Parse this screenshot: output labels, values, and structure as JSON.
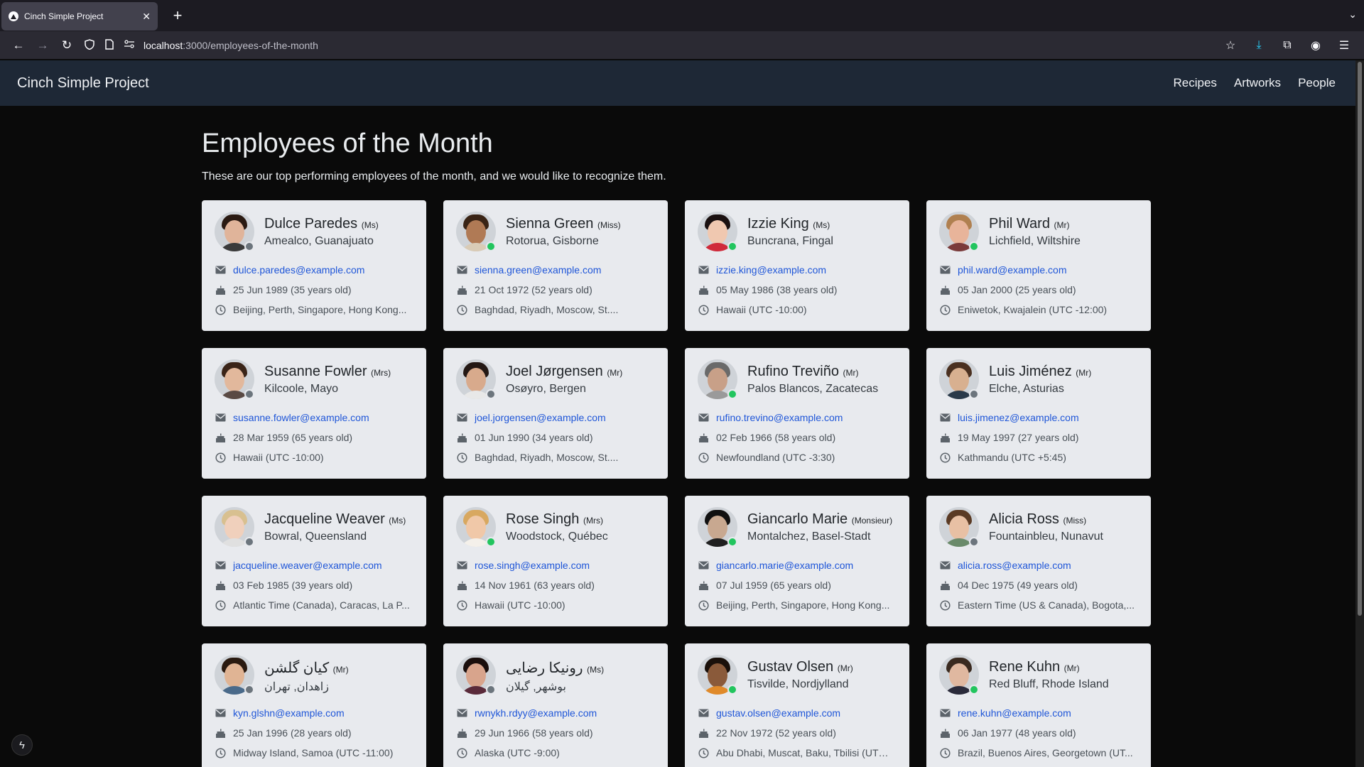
{
  "browser": {
    "tab_title": "Cinch Simple Project",
    "url_host": "localhost",
    "url_path": ":3000/employees-of-the-month"
  },
  "site": {
    "brand": "Cinch Simple Project",
    "nav": [
      "Recipes",
      "Artworks",
      "People"
    ]
  },
  "page": {
    "title": "Employees of the Month",
    "subtitle": "These are our top performing employees of the month, and we would like to recognize them."
  },
  "employees": [
    {
      "name": "Dulce Paredes",
      "title": "(Ms)",
      "location": "Amealco, Guanajuato",
      "email": "dulce.paredes@example.com",
      "birthday": "25 Jun 1989 (35 years old)",
      "timezone": "Beijing, Perth, Singapore, Hong Kong...",
      "online": false,
      "skin": "#e0b49a",
      "hair": "#2a1a12",
      "shirt": "#3b3b3b"
    },
    {
      "name": "Sienna Green",
      "title": "(Miss)",
      "location": "Rotorua, Gisborne",
      "email": "sienna.green@example.com",
      "birthday": "21 Oct 1972 (52 years old)",
      "timezone": "Baghdad, Riyadh, Moscow, St....",
      "online": true,
      "skin": "#b07a55",
      "hair": "#3a2416",
      "shirt": "#d9cbb6"
    },
    {
      "name": "Izzie King",
      "title": "(Ms)",
      "location": "Buncrana, Fingal",
      "email": "izzie.king@example.com",
      "birthday": "05 May 1986 (38 years old)",
      "timezone": "Hawaii (UTC -10:00)",
      "online": true,
      "skin": "#f0c8b0",
      "hair": "#1a1010",
      "shirt": "#d02a3a"
    },
    {
      "name": "Phil Ward",
      "title": "(Mr)",
      "location": "Lichfield, Wiltshire",
      "email": "phil.ward@example.com",
      "birthday": "05 Jan 2000 (25 years old)",
      "timezone": "Eniwetok, Kwajalein (UTC -12:00)",
      "online": true,
      "skin": "#e8b49a",
      "hair": "#b08050",
      "shirt": "#7a3b3b"
    },
    {
      "name": "Susanne Fowler",
      "title": "(Mrs)",
      "location": "Kilcoole, Mayo",
      "email": "susanne.fowler@example.com",
      "birthday": "28 Mar 1959 (65 years old)",
      "timezone": "Hawaii (UTC -10:00)",
      "online": false,
      "skin": "#e2b89c",
      "hair": "#3a2418",
      "shirt": "#5a4a44"
    },
    {
      "name": "Joel Jørgensen",
      "title": "(Mr)",
      "location": "Osøyro, Bergen",
      "email": "joel.jorgensen@example.com",
      "birthday": "01 Jun 1990 (34 years old)",
      "timezone": "Baghdad, Riyadh, Moscow, St....",
      "online": false,
      "skin": "#d8aa8c",
      "hair": "#241814",
      "shirt": "#e8e8e8"
    },
    {
      "name": "Rufino Treviño",
      "title": "(Mr)",
      "location": "Palos Blancos, Zacatecas",
      "email": "rufino.trevino@example.com",
      "birthday": "02 Feb 1966 (58 years old)",
      "timezone": "Newfoundland (UTC -3:30)",
      "online": true,
      "skin": "#c8a088",
      "hair": "#6a6a6a",
      "shirt": "#9a9a9a"
    },
    {
      "name": "Luis Jiménez",
      "title": "(Mr)",
      "location": "Elche, Asturias",
      "email": "luis.jimenez@example.com",
      "birthday": "19 May 1997 (27 years old)",
      "timezone": "Kathmandu (UTC +5:45)",
      "online": false,
      "skin": "#d8b090",
      "hair": "#4a3020",
      "shirt": "#2a3a4a"
    },
    {
      "name": "Jacqueline Weaver",
      "title": "(Ms)",
      "location": "Bowral, Queensland",
      "email": "jacqueline.weaver@example.com",
      "birthday": "03 Feb 1985 (39 years old)",
      "timezone": "Atlantic Time (Canada), Caracas, La P...",
      "online": false,
      "skin": "#f0d0bc",
      "hair": "#d8c090",
      "shirt": "#e0e0e0"
    },
    {
      "name": "Rose Singh",
      "title": "(Mrs)",
      "location": "Woodstock, Québec",
      "email": "rose.singh@example.com",
      "birthday": "14 Nov 1961 (63 years old)",
      "timezone": "Hawaii (UTC -10:00)",
      "online": true,
      "skin": "#f0c8a8",
      "hair": "#d8a860",
      "shirt": "#f4f0ea"
    },
    {
      "name": "Giancarlo Marie",
      "title": "(Monsieur)",
      "location": "Montalchez, Basel-Stadt",
      "email": "giancarlo.marie@example.com",
      "birthday": "07 Jul 1959 (65 years old)",
      "timezone": "Beijing, Perth, Singapore, Hong Kong...",
      "online": true,
      "skin": "#c8a890",
      "hair": "#101010",
      "shirt": "#202020"
    },
    {
      "name": "Alicia Ross",
      "title": "(Miss)",
      "location": "Fountainbleu, Nunavut",
      "email": "alicia.ross@example.com",
      "birthday": "04 Dec 1975 (49 years old)",
      "timezone": "Eastern Time (US & Canada), Bogota,...",
      "online": false,
      "skin": "#e8c0a4",
      "hair": "#5a3a24",
      "shirt": "#6a8a6a"
    },
    {
      "name": "کیان گلشن",
      "title": "(Mr)",
      "rtl": true,
      "location": "زاهدان, تهران",
      "email": "kyn.glshn@example.com",
      "birthday": "25 Jan 1996 (28 years old)",
      "timezone": "Midway Island, Samoa (UTC -11:00)",
      "online": false,
      "skin": "#e0b494",
      "hair": "#2a1a10",
      "shirt": "#4a6a8a"
    },
    {
      "name": "رونیکا رضایی",
      "title": "(Ms)",
      "rtl": true,
      "location": "بوشهر, گیلان",
      "email": "rwnykh.rdyy@example.com",
      "birthday": "29 Jun 1966 (58 years old)",
      "timezone": "Alaska (UTC -9:00)",
      "online": false,
      "skin": "#d8a48c",
      "hair": "#1a0e0c",
      "shirt": "#5a2a3a"
    },
    {
      "name": "Gustav Olsen",
      "title": "(Mr)",
      "location": "Tisvilde, Nordjylland",
      "email": "gustav.olsen@example.com",
      "birthday": "22 Nov 1972 (52 years old)",
      "timezone": "Abu Dhabi, Muscat, Baku, Tbilisi (UTC...",
      "online": true,
      "skin": "#8a5a3a",
      "hair": "#1a100a",
      "shirt": "#e08a2a"
    },
    {
      "name": "Rene Kuhn",
      "title": "(Mr)",
      "location": "Red Bluff, Rhode Island",
      "email": "rene.kuhn@example.com",
      "birthday": "06 Jan 1977 (48 years old)",
      "timezone": "Brazil, Buenos Aires, Georgetown (UT...",
      "online": true,
      "skin": "#e0b8a0",
      "hair": "#3a2a20",
      "shirt": "#2a2a3a"
    }
  ]
}
